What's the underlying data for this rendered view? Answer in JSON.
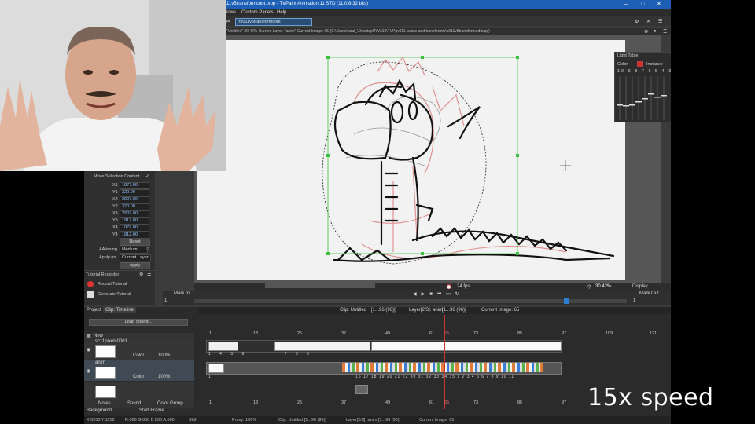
{
  "titlebar": {
    "title": "11v5transformcont.tvpp - TVPaint Animation 11 STD (11.0.8-32 bits)"
  },
  "menubar": {
    "items": [
      "iows",
      "Custom Panels",
      "Help"
    ]
  },
  "doc_tab": {
    "label": "*tv011v5transformcont"
  },
  "infobar": {
    "text": "Clip: \"Untitled\"   30.42%   Current Layer: \"anim\"   Current Image: 65 (C:\\Users\\paul_\\Desktop\\TrVs10\\TVPpv011 avaxe and transformtv\\c011v5transformed.tvpp)"
  },
  "selection_panel": {
    "title": "Move Selection Content",
    "fields": [
      {
        "label": "X1",
        "value": "1077.00"
      },
      {
        "label": "Y1",
        "value": "320.00"
      },
      {
        "label": "X2",
        "value": "2907.00"
      },
      {
        "label": "Y2",
        "value": "320.00"
      },
      {
        "label": "X3",
        "value": "2907.00"
      },
      {
        "label": "Y3",
        "value": "1912.00"
      },
      {
        "label": "X4",
        "value": "1077.00"
      },
      {
        "label": "Y4",
        "value": "1912.00"
      }
    ],
    "reset_label": "Reset",
    "aaliasing_label": "AAliasing",
    "aaliasing_value": "Medium",
    "apply_on_label": "Apply on",
    "apply_on_value": "Current Layer",
    "apply_label": "Apply"
  },
  "tutorial_panel": {
    "title": "Tutorial Recorder",
    "record_label": "Record Tutorial",
    "generate_label": "Generate Tutorial"
  },
  "light_table": {
    "title": "Light Table",
    "color_label": "Color",
    "instance_label": "Instance",
    "numbers": [
      "10",
      "9",
      "8",
      "7",
      "6",
      "5",
      "4",
      "3"
    ]
  },
  "viewbar": {
    "fps": "24 fps",
    "zoom": "30.42%",
    "display": "Display",
    "mark_in_label": "Mark In",
    "mark_in_value": "1",
    "mark_out_label": "Mark Out",
    "mark_out_value": "1"
  },
  "timeline": {
    "tabs": [
      "Project",
      "Clip: Timeline"
    ],
    "load_sound": "Load Sound...",
    "header_clip": "Clip: Untitled",
    "header_range": "[1...96 (96)]",
    "header_layer": "Layer[2/3]: anim",
    "header_layer_range": "[1...96 (96)]",
    "header_image": "Current Image: 65",
    "new_label": "New",
    "ruler": [
      "1",
      "13",
      "25",
      "37",
      "49",
      "61",
      "65",
      "73",
      "85",
      "97",
      "109",
      "121"
    ],
    "layers": [
      {
        "name": "sc11pixels0001",
        "mode": "Color",
        "opacity": "100%",
        "frames": [
          "1",
          "4",
          "5",
          "6",
          "7",
          "8",
          "9"
        ]
      },
      {
        "name": "anim",
        "mode": "Color",
        "opacity": "100%",
        "frames": [
          "1",
          "16",
          "17",
          "18",
          "19",
          "20",
          "21",
          "22",
          "30",
          "31",
          "32",
          "33",
          "34",
          "35",
          "1",
          "2",
          "3",
          "4",
          "5",
          "6",
          "7",
          "8",
          "9",
          "10",
          "11",
          "12",
          "13",
          "14",
          "15",
          "16",
          "21",
          "23",
          "24",
          "25",
          "26",
          "27"
        ]
      }
    ],
    "bottom_tabs": [
      "Notes",
      "Sound",
      "Color Group"
    ],
    "background_label": "Background",
    "start_frame_label": "Start Frame",
    "bottom_ruler": [
      "1",
      "13",
      "25",
      "37",
      "49",
      "61",
      "65",
      "73",
      "85",
      "97"
    ]
  },
  "statusbar": {
    "coords": "X:5203  Y:1158",
    "rgba": "R:000 G:000 B:000 A:000",
    "modifier": "Shift",
    "proxy": "Proxy: 100%",
    "clip": "Clip: Untitled [1...96 (96)]",
    "layer": "Layer[2/3]: anim [1...96 (96)]",
    "image": "Current Image: 65"
  },
  "overlay": {
    "speed_text": "15x speed"
  },
  "colors": {
    "titlebar": "#1d5fb5",
    "selection_box": "#3fbf3f",
    "sketch_red": "#e05a5a",
    "timeline_bg": "#2b2b2b"
  }
}
